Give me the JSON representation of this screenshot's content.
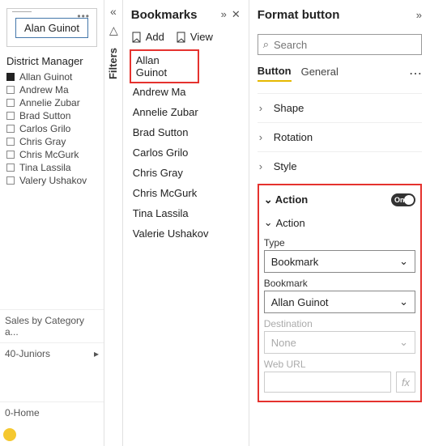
{
  "left": {
    "card_button": "Alan Guinot",
    "dm_title": "District Manager",
    "dm_items": [
      {
        "label": "Allan Guinot",
        "checked": true
      },
      {
        "label": "Andrew Ma",
        "checked": false
      },
      {
        "label": "Annelie Zubar",
        "checked": false
      },
      {
        "label": "Brad Sutton",
        "checked": false
      },
      {
        "label": "Carlos Grilo",
        "checked": false
      },
      {
        "label": "Chris Gray",
        "checked": false
      },
      {
        "label": "Chris McGurk",
        "checked": false
      },
      {
        "label": "Tina Lassila",
        "checked": false
      },
      {
        "label": "Valery Ushakov",
        "checked": false
      }
    ],
    "bottom1": "Sales by Category a...",
    "bottom2": "40-Juniors",
    "bottom3": "0-Home"
  },
  "filters": {
    "label": "Filters"
  },
  "bookmarks": {
    "title": "Bookmarks",
    "add": "Add",
    "view": "View",
    "items": [
      "Allan Guinot",
      "Andrew Ma",
      "Annelie Zubar",
      "Brad Sutton",
      "Carlos Grilo",
      "Chris Gray",
      "Chris McGurk",
      "Tina Lassila",
      "Valerie Ushakov"
    ]
  },
  "format": {
    "title": "Format button",
    "search_placeholder": "Search",
    "tabs": {
      "button": "Button",
      "general": "General"
    },
    "sections": {
      "shape": "Shape",
      "rotation": "Rotation",
      "style": "Style"
    },
    "action": {
      "header": "Action",
      "toggle": "On",
      "sub": "Action",
      "type_label": "Type",
      "type_value": "Bookmark",
      "bookmark_label": "Bookmark",
      "bookmark_value": "Allan Guinot",
      "dest_label": "Destination",
      "dest_value": "None",
      "url_label": "Web URL",
      "fx": "fx"
    }
  }
}
